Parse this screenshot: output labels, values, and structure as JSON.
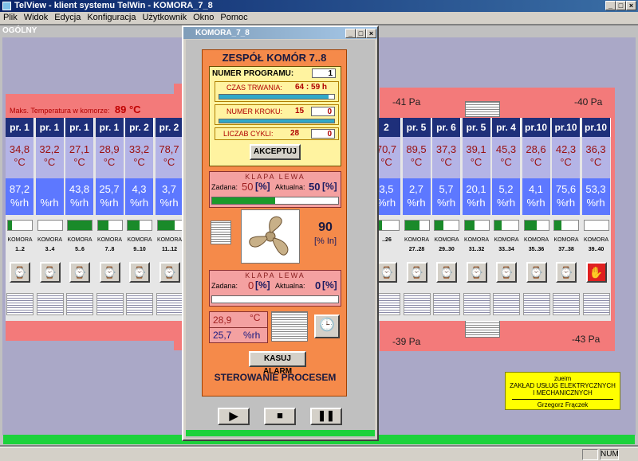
{
  "window": {
    "title": "TelView - klient systemu TelWin - KOMORA_7_8"
  },
  "menu": [
    "Plik",
    "Widok",
    "Edycja",
    "Konfiguracja",
    "Użytkownik",
    "Okno",
    "Pomoc"
  ],
  "view": {
    "title": "OGÓLNY"
  },
  "max_temp": {
    "label": "Maks. Temperatura w komorze:",
    "value": "89 °C"
  },
  "pressures": {
    "top_1": "-41 Pa",
    "top_2": "-40 Pa",
    "bottom_1": "-39 Pa",
    "bottom_2": "-43 Pa"
  },
  "left_chambers": [
    {
      "prog": "pr. 1",
      "temp": "34,8",
      "hum": "87,2",
      "name": "KOMORA",
      "range": "1..2",
      "fill": 0.18
    },
    {
      "prog": "pr. 1",
      "temp": "32,2",
      "hum": "",
      "name": "KOMORA",
      "range": "3..4",
      "fill": 0.0
    },
    {
      "prog": "pr. 1",
      "temp": "27,1",
      "hum": "43,8",
      "name": "KOMORA",
      "range": "5..6",
      "fill": 1.0
    },
    {
      "prog": "pr. 1",
      "temp": "28,9",
      "hum": "25,7",
      "name": "KOMORA",
      "range": "7..8",
      "fill": 0.45
    },
    {
      "prog": "pr. 2",
      "temp": "33,2",
      "hum": "4,3",
      "name": "KOMORA",
      "range": "9..10",
      "fill": 0.5
    },
    {
      "prog": "pr. 2",
      "temp": "78,7",
      "hum": "3,7",
      "name": "KOMORA",
      "range": "11..12",
      "fill": 0.7
    }
  ],
  "right_chambers": [
    {
      "prog": "2",
      "temp": "70,7",
      "hum": "3,5",
      "name": "",
      "range": "..26",
      "fill": 0.3
    },
    {
      "prog": "pr. 5",
      "temp": "89,5",
      "hum": "2,7",
      "name": "KOMORA",
      "range": "27..28",
      "fill": 0.6
    },
    {
      "prog": "pr. 6",
      "temp": "37,3",
      "hum": "5,7",
      "name": "KOMORA",
      "range": "29..30",
      "fill": 0.35
    },
    {
      "prog": "pr. 5",
      "temp": "39,1",
      "hum": "20,1",
      "name": "KOMORA",
      "range": "31..32",
      "fill": 0.4
    },
    {
      "prog": "pr. 4",
      "temp": "45,3",
      "hum": "5,2",
      "name": "KOMORA",
      "range": "33..34",
      "fill": 0.3
    },
    {
      "prog": "pr.10",
      "temp": "28,6",
      "hum": "4,1",
      "name": "KOMORA",
      "range": "35..36",
      "fill": 0.5
    },
    {
      "prog": "pr.10",
      "temp": "42,3",
      "hum": "75,6",
      "name": "KOMORA",
      "range": "37..38",
      "fill": 0.3
    },
    {
      "prog": "pr.10",
      "temp": "36,3",
      "hum": "53,3",
      "name": "KOMORA",
      "range": "39..40",
      "fill": 0.0
    }
  ],
  "units": {
    "temp": "°C",
    "hum": "%rh"
  },
  "dialog": {
    "title": "KOMORA_7_8",
    "header": "ZESPÓŁ KOMÓR 7..8",
    "program_label": "NUMER PROGRAMU:",
    "program_value": "1",
    "duration_label": "CZAS TRWANIA:",
    "duration_value": "64 : 59 h",
    "duration_fill": 0.95,
    "step_label": "NUMER KROKU:",
    "step_value": "15",
    "step_value2": "0",
    "step_fill": 1.0,
    "cycles_label": "LICZAB CYKLI:",
    "cycles_value": "28",
    "cycles_value2": "0",
    "accept_button": "AKCEPTUJ",
    "damper1_title": "KLAPA LEWA",
    "damper1_set_label": "Zadana:",
    "damper1_set": "50",
    "damper1_act_label": "Aktualna:",
    "damper1_act": "50",
    "damper1_fill": 0.5,
    "percent_unit": "[%]",
    "fan_value": "90",
    "fan_unit": "[% In]",
    "damper2_title": "KLAPA LEWA",
    "damper2_set_label": "Zadana:",
    "damper2_set": "0",
    "damper2_act_label": "Aktualna:",
    "damper2_act": "0",
    "damper2_fill": 0.0,
    "temp_value": "28,9",
    "temp_unit": "°C",
    "hum_value": "25,7",
    "hum_unit": "%rh",
    "reset_button": "KASUJ ALARM",
    "process_title": "STEROWANIE PROCESEM"
  },
  "company": {
    "line1": "zueim",
    "line2": "ZAKŁAD USŁUG ELEKTRYCZNYCH",
    "line3": "I MECHANICZNYCH",
    "line4": "Grzegorz Frączek"
  },
  "status": {
    "num": "NUM"
  },
  "colors": {
    "header": "#1e2f7a",
    "temp_bg": "#b4b4e6",
    "hum_bg": "#5d78ff",
    "dialog_orange": "#f58a4a",
    "alarm_red": "#e02020"
  }
}
